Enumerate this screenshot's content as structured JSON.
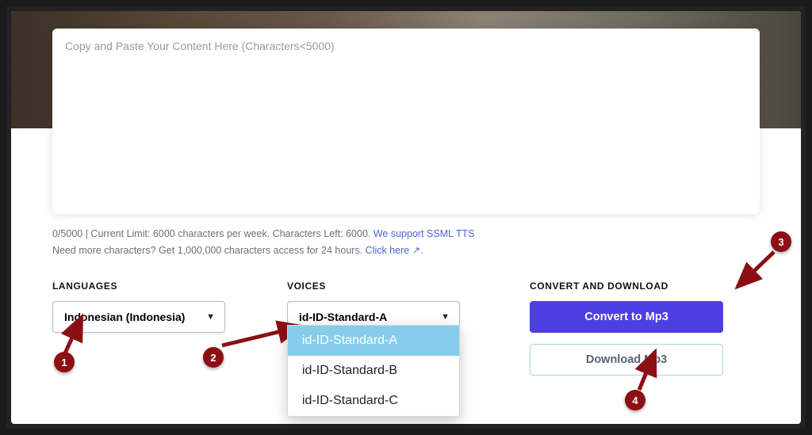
{
  "textarea": {
    "placeholder": "Copy and Paste Your Content Here (Characters<5000)"
  },
  "status": {
    "count_line": "0/5000 | Current Limit: 6000 characters per week. Characters Left: 6000.",
    "ssml_link": "We support SSML TTS",
    "more_line": "Need more characters? Get 1,000,000 characters access for 24 hours.",
    "click_here": "Click here ↗."
  },
  "labels": {
    "languages": "LANGUAGES",
    "voices": "VOICES",
    "convert": "CONVERT AND DOWNLOAD"
  },
  "language_select": {
    "value": "Indonesian (Indonesia)"
  },
  "voice_select": {
    "value": "id-ID-Standard-A",
    "options": [
      "id-ID-Standard-A",
      "id-ID-Standard-B",
      "id-ID-Standard-C"
    ],
    "selected_index": 0
  },
  "buttons": {
    "convert": "Convert to Mp3",
    "download": "Download Mp3"
  },
  "badges": {
    "b1": "1",
    "b2": "2",
    "b3": "3",
    "b4": "4"
  }
}
